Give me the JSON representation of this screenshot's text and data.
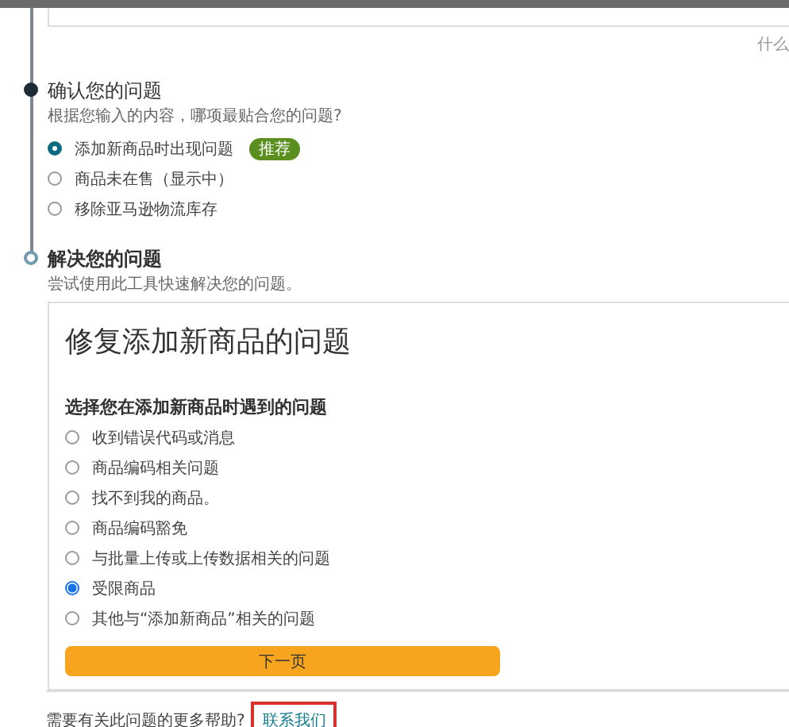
{
  "hint_link": "什么",
  "confirm_step": {
    "title": "确认您的问题",
    "subtitle": "根据您输入的内容，哪项最贴合您的问题?",
    "completed": true,
    "options": [
      {
        "label": "添加新商品时出现问题",
        "selected": true,
        "badge": "推荐"
      },
      {
        "label": "商品未在售（显示中）",
        "selected": false
      },
      {
        "label": "移除亚马逊物流库存",
        "selected": false
      }
    ]
  },
  "solve_step": {
    "title": "解决您的问题",
    "subtitle": "尝试使用此工具快速解决您的问题。",
    "completed": false
  },
  "fix_card": {
    "title": "修复添加新商品的问题",
    "question": "选择您在添加新商品时遇到的问题",
    "options": [
      {
        "label": "收到错误代码或消息",
        "selected": false
      },
      {
        "label": "商品编码相关问题",
        "selected": false
      },
      {
        "label": "找不到我的商品。",
        "selected": false
      },
      {
        "label": "商品编码豁免",
        "selected": false
      },
      {
        "label": "与批量上传或上传数据相关的问题",
        "selected": false
      },
      {
        "label": "受限商品",
        "selected": true
      },
      {
        "label": "其他与“添加新商品”相关的问题",
        "selected": false
      }
    ],
    "next_button": "下一页"
  },
  "help": {
    "text": "需要有关此问题的更多帮助?",
    "link": "联系我们",
    "highlighted": true
  }
}
